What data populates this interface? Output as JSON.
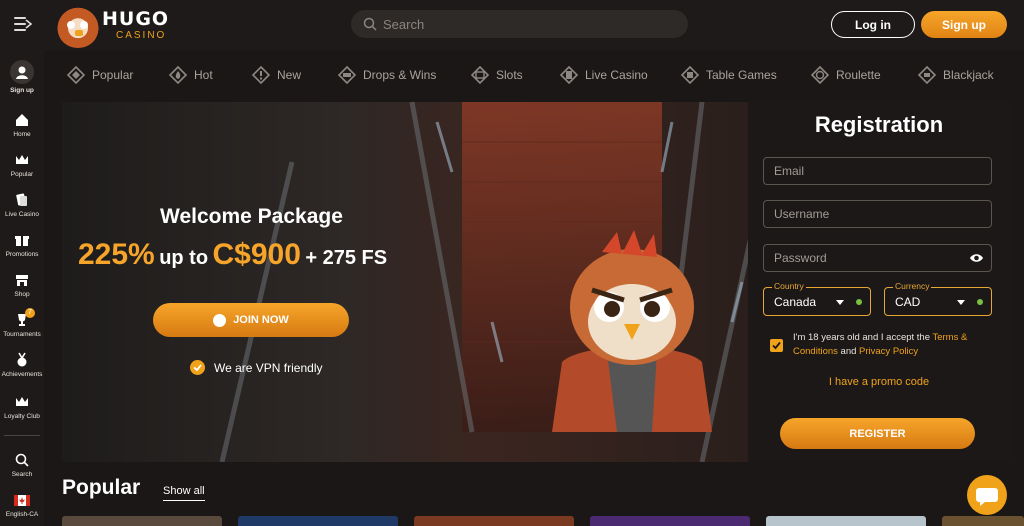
{
  "header": {
    "logo_text": "HUGO",
    "logo_sub": "CASINO",
    "search_placeholder": "Search",
    "login_label": "Log in",
    "signup_label": "Sign up"
  },
  "sidebar": {
    "items": [
      {
        "label": "Sign up",
        "icon": "user-icon"
      },
      {
        "label": "Home",
        "icon": "home-icon"
      },
      {
        "label": "Popular",
        "icon": "crown-icon"
      },
      {
        "label": "Live Casino",
        "icon": "cards-icon"
      },
      {
        "label": "Promotions",
        "icon": "gift-icon"
      },
      {
        "label": "Shop",
        "icon": "shop-icon"
      },
      {
        "label": "Tournaments",
        "icon": "trophy-icon"
      },
      {
        "label": "Achievements",
        "icon": "medal-icon"
      },
      {
        "label": "Loyalty Club",
        "icon": "crown-icon"
      },
      {
        "label": "Search",
        "icon": "search-icon"
      },
      {
        "label": "English-CA",
        "icon": "canada-flag-icon"
      }
    ],
    "tournaments_badge": "7"
  },
  "categories": [
    {
      "label": "Popular",
      "icon": "diamond-icon"
    },
    {
      "label": "Hot",
      "icon": "flame-icon"
    },
    {
      "label": "New",
      "icon": "new-icon"
    },
    {
      "label": "Drops & Wins",
      "icon": "drops-icon"
    },
    {
      "label": "Slots",
      "icon": "slots-icon"
    },
    {
      "label": "Live Casino",
      "icon": "live-casino-icon"
    },
    {
      "label": "Table Games",
      "icon": "dice-icon"
    },
    {
      "label": "Roulette",
      "icon": "roulette-icon"
    },
    {
      "label": "Blackjack",
      "icon": "blackjack-icon"
    }
  ],
  "hero": {
    "title": "Welcome Package",
    "percent": "225%",
    "up_to": "up to",
    "amount": "C$900",
    "free_spins": "+ 275 FS",
    "join_label": "JOIN NOW",
    "vpn_text": "We are VPN friendly"
  },
  "registration": {
    "title": "Registration",
    "email_placeholder": "Email",
    "username_placeholder": "Username",
    "password_placeholder": "Password",
    "country_label": "Country",
    "country_value": "Canada",
    "currency_label": "Currency",
    "currency_value": "CAD",
    "terms_text": "I'm 18 years old and I accept the ",
    "terms_link": "Terms & Conditions",
    "terms_and": " and ",
    "privacy_link": "Privacy Policy",
    "promo_label": "I have a promo code",
    "register_label": "REGISTER",
    "checkbox_checked": true
  },
  "popular": {
    "title": "Popular",
    "show_all": "Show all"
  },
  "colors": {
    "accent": "#f0a21a",
    "background": "#1a1716",
    "panel": "#1b1817",
    "success_dot": "#7bc043"
  }
}
